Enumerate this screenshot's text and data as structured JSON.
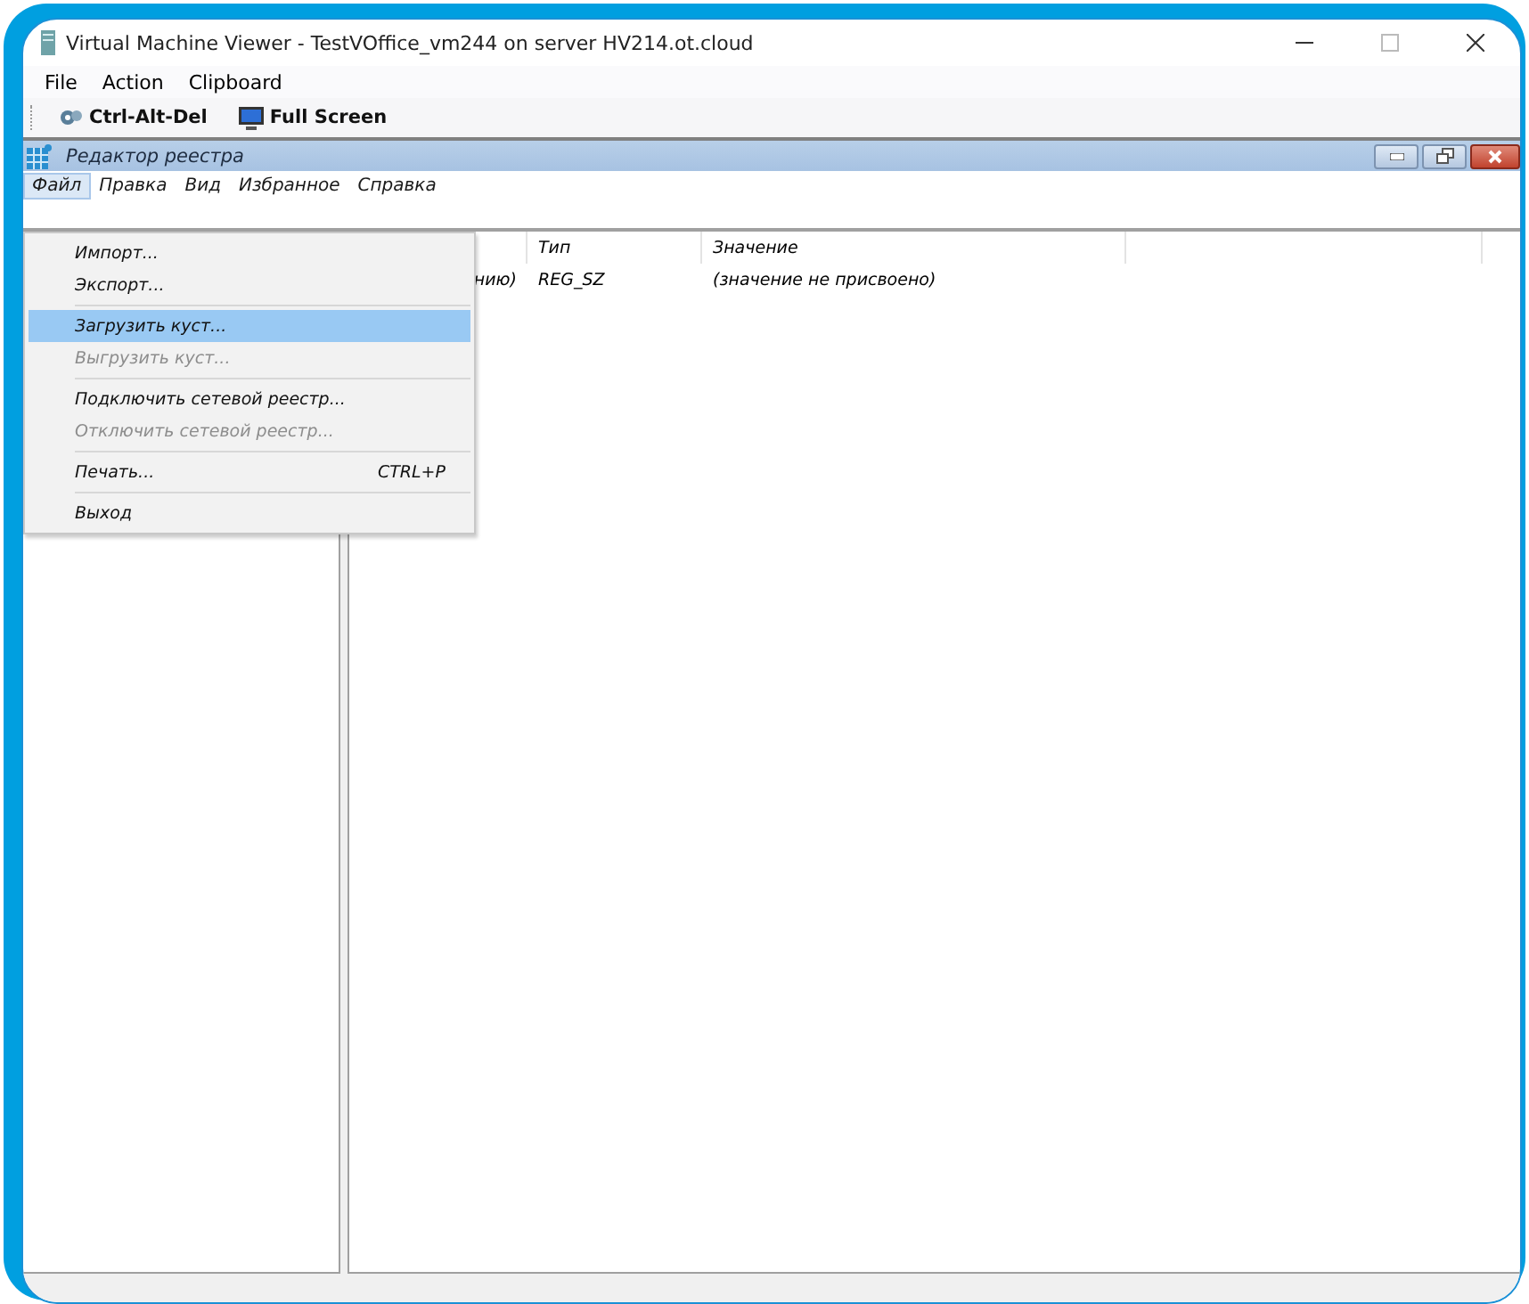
{
  "window": {
    "title": "Virtual Machine Viewer - TestVOffice_vm244 on server HV214.ot.cloud"
  },
  "menubar": [
    "File",
    "Action",
    "Clipboard"
  ],
  "toolbar": [
    {
      "kind": "keys",
      "label": "Ctrl-Alt-Del"
    },
    {
      "kind": "screen",
      "label": "Full Screen"
    }
  ],
  "regedit": {
    "title": "Редактор реестра",
    "menubar": [
      {
        "label": "Файл",
        "selected": true
      },
      {
        "label": "Правка",
        "selected": false
      },
      {
        "label": "Вид",
        "selected": false
      },
      {
        "label": "Избранное",
        "selected": false
      },
      {
        "label": "Справка",
        "selected": false
      }
    ],
    "columns": [
      "Тип",
      "Значение"
    ],
    "rows": [
      {
        "name": "нию)",
        "type": "REG_SZ",
        "value": "(значение не присвоено)"
      }
    ],
    "file_menu": [
      {
        "kind": "item",
        "label": "Импорт...",
        "disabled": false,
        "selected": false
      },
      {
        "kind": "item",
        "label": "Экспорт...",
        "disabled": false,
        "selected": false
      },
      {
        "kind": "separator"
      },
      {
        "kind": "item",
        "label": "Загрузить куст...",
        "disabled": false,
        "selected": true
      },
      {
        "kind": "item",
        "label": "Выгрузить куст...",
        "disabled": true,
        "selected": false
      },
      {
        "kind": "separator"
      },
      {
        "kind": "item",
        "label": "Подключить сетевой реестр...",
        "disabled": false,
        "selected": false
      },
      {
        "kind": "item",
        "label": "Отключить сетевой реестр...",
        "disabled": true,
        "selected": false
      },
      {
        "kind": "separator"
      },
      {
        "kind": "item",
        "label": "Печать...",
        "shortcut": "CTRL+P",
        "disabled": false,
        "selected": false
      },
      {
        "kind": "separator"
      },
      {
        "kind": "item",
        "label": "Выход",
        "disabled": false,
        "selected": false
      }
    ]
  }
}
